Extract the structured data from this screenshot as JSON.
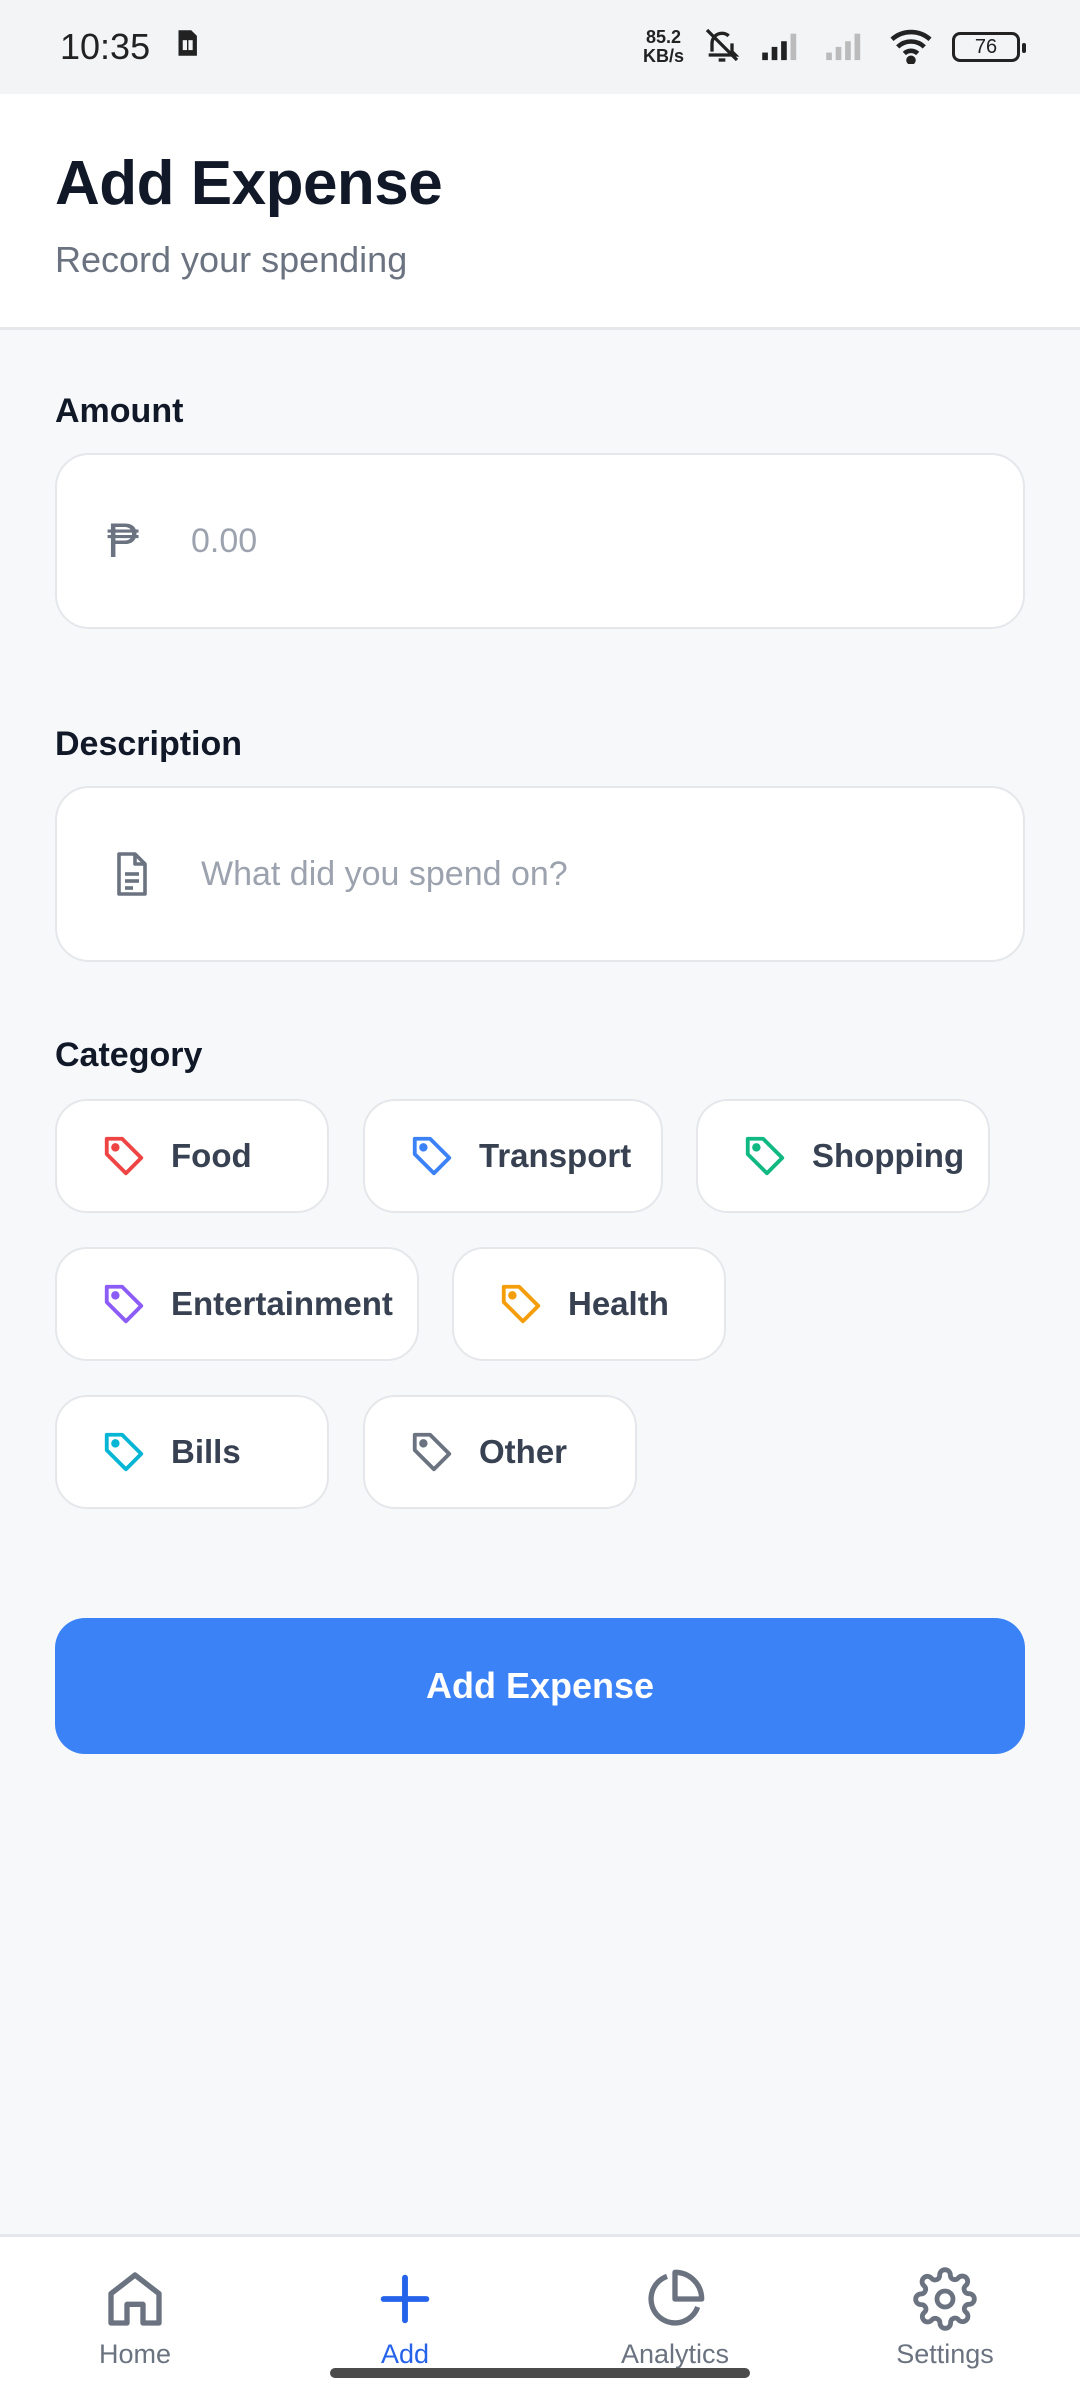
{
  "status": {
    "time": "10:35",
    "netspeed_value": "85.2",
    "netspeed_unit": "KB/s",
    "battery": "76"
  },
  "header": {
    "title": "Add Expense",
    "subtitle": "Record your spending"
  },
  "form": {
    "amount_label": "Amount",
    "amount_currency": "₱",
    "amount_placeholder": "0.00",
    "description_label": "Description",
    "description_placeholder": "What did you spend on?",
    "category_label": "Category",
    "categories": [
      {
        "label": "Food",
        "color": "#ef4444"
      },
      {
        "label": "Transport",
        "color": "#3b82f6"
      },
      {
        "label": "Shopping",
        "color": "#10b981"
      },
      {
        "label": "Entertainment",
        "color": "#8b5cf6"
      },
      {
        "label": "Health",
        "color": "#f59e0b"
      },
      {
        "label": "Bills",
        "color": "#06b6d4"
      },
      {
        "label": "Other",
        "color": "#6b7280"
      }
    ],
    "submit_label": "Add Expense"
  },
  "nav": {
    "items": [
      {
        "label": "Home",
        "icon": "home-icon"
      },
      {
        "label": "Add",
        "icon": "plus-icon"
      },
      {
        "label": "Analytics",
        "icon": "pie-chart-icon"
      },
      {
        "label": "Settings",
        "icon": "gear-icon"
      }
    ],
    "active_index": 1,
    "active_color": "#2563eb",
    "inactive_color": "#6b7280"
  }
}
